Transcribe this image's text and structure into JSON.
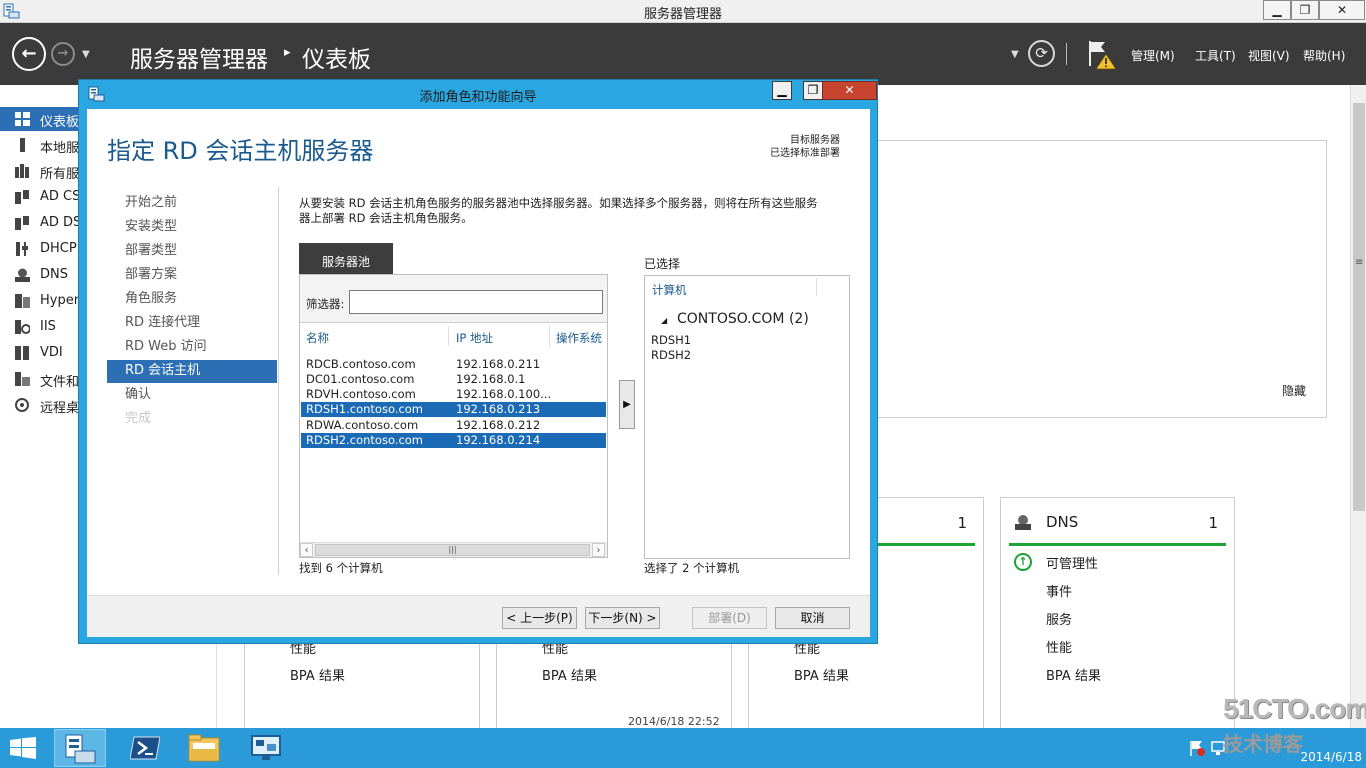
{
  "window": {
    "title": "服务器管理器",
    "controls": {
      "minimize": "▁",
      "maximize": "❐",
      "close": "✕"
    }
  },
  "header": {
    "breadcrumb_root": "服务器管理器",
    "breadcrumb_sep": "▸",
    "breadcrumb_page": "仪表板",
    "menus": [
      "管理(M)",
      "工具(T)",
      "视图(V)",
      "帮助(H)"
    ]
  },
  "leftnav": {
    "items": [
      {
        "label": "仪表板",
        "icon": "dashboard-icon",
        "selected": true
      },
      {
        "label": "本地服",
        "icon": "local-server-icon"
      },
      {
        "label": "所有服",
        "icon": "all-servers-icon"
      },
      {
        "label": "AD CS",
        "icon": "ad-cs-icon"
      },
      {
        "label": "AD DS",
        "icon": "ad-ds-icon"
      },
      {
        "label": "DHCP",
        "icon": "dhcp-icon"
      },
      {
        "label": "DNS",
        "icon": "dns-icon"
      },
      {
        "label": "Hyper",
        "icon": "hyperv-icon"
      },
      {
        "label": "IIS",
        "icon": "iis-icon"
      },
      {
        "label": "VDI",
        "icon": "vdi-icon"
      },
      {
        "label": "文件和",
        "icon": "file-services-icon"
      },
      {
        "label": "远程桌",
        "icon": "remote-desktop-icon"
      }
    ]
  },
  "background": {
    "hide_link": "隐藏",
    "tile_dns": {
      "name": "DNS",
      "count": "1",
      "rows": [
        "可管理性",
        "事件",
        "服务",
        "性能",
        "BPA 结果"
      ]
    },
    "tile_other_count": "1",
    "tile_perf": "性能",
    "tile_bpa": "BPA 结果",
    "timestamp": "2014/6/18 22:52"
  },
  "wizard": {
    "title": "添加角色和功能向导",
    "heading": "指定 RD 会话主机服务器",
    "dest_line1": "目标服务器",
    "dest_line2": "已选择标准部署",
    "steps": [
      {
        "label": "开始之前",
        "state": "normal"
      },
      {
        "label": "安装类型",
        "state": "normal"
      },
      {
        "label": "部署类型",
        "state": "normal"
      },
      {
        "label": "部署方案",
        "state": "normal"
      },
      {
        "label": "角色服务",
        "state": "normal"
      },
      {
        "label": "RD 连接代理",
        "state": "normal"
      },
      {
        "label": "RD Web 访问",
        "state": "normal"
      },
      {
        "label": "RD 会话主机",
        "state": "selected"
      },
      {
        "label": "确认",
        "state": "normal"
      },
      {
        "label": "完成",
        "state": "disabled"
      }
    ],
    "description_line1": "从要安装 RD 会话主机角色服务的服务器池中选择服务器。如果选择多个服务器，则将在所有这些服务",
    "description_line2": "器上部署 RD 会话主机角色服务。",
    "pool_tab": "服务器池",
    "filter_label": "筛选器:",
    "filter_value": "",
    "columns": [
      "名称",
      "IP 地址",
      "操作系统"
    ],
    "rows": [
      {
        "name": "RDCB.contoso.com",
        "ip": "192.168.0.211",
        "selected": false
      },
      {
        "name": "DC01.contoso.com",
        "ip": "192.168.0.1",
        "selected": false
      },
      {
        "name": "RDVH.contoso.com",
        "ip": "192.168.0.100...",
        "selected": false
      },
      {
        "name": "RDSH1.contoso.com",
        "ip": "192.168.0.213",
        "selected": true
      },
      {
        "name": "RDWA.contoso.com",
        "ip": "192.168.0.212",
        "selected": false
      },
      {
        "name": "RDSH2.contoso.com",
        "ip": "192.168.0.214",
        "selected": true
      }
    ],
    "found_count": "找到 6 个计算机",
    "add_arrow": "▶",
    "selected_label": "已选择",
    "selected_col": "计算机",
    "selected_group": "CONTOSO.COM (2)",
    "selected_items": [
      "RDSH1",
      "RDSH2"
    ],
    "selected_count": "选择了 2 个计算机",
    "buttons": {
      "prev": "< 上一步(P)",
      "next": "下一步(N) >",
      "deploy": "部署(D)",
      "cancel": "取消"
    }
  },
  "taskbar": {
    "time": "",
    "date": "2014/6/18"
  },
  "watermark": {
    "line1": "51CTO.com",
    "line2": "技术博客"
  },
  "colors": {
    "dialog_frame": "#2aa6e0",
    "selection": "#1b6ab6",
    "heading": "#1b5a8e",
    "taskbar": "#2a9ad8",
    "header_bg": "#3b3b3b",
    "status_green": "#1ba336"
  }
}
